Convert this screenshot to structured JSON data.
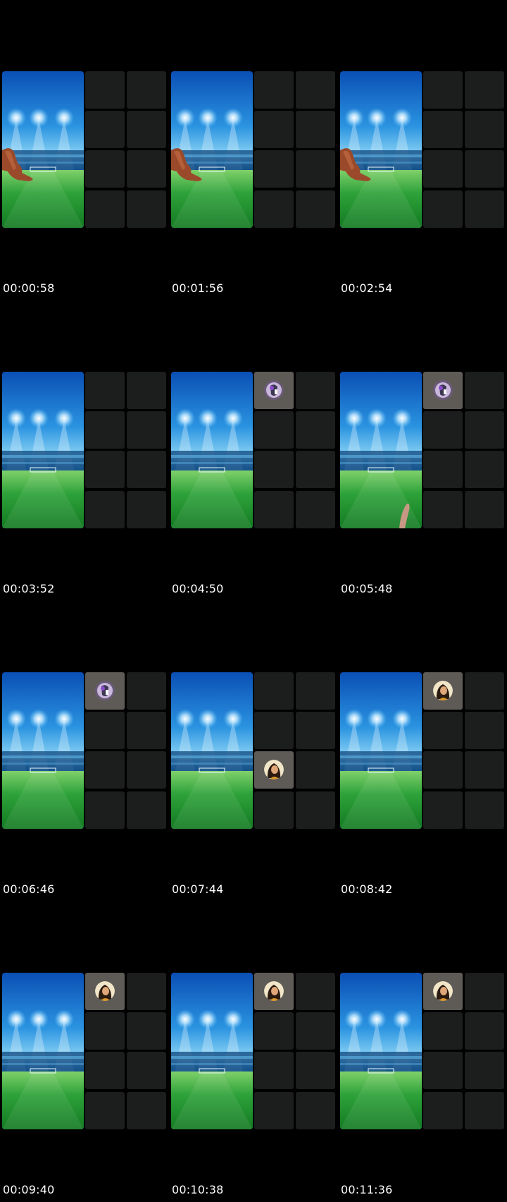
{
  "frames": [
    {
      "timestamp": "00:00:58",
      "leg": "full",
      "avatar": null
    },
    {
      "timestamp": "00:01:56",
      "leg": "full",
      "avatar": null
    },
    {
      "timestamp": "00:02:54",
      "leg": "full",
      "avatar": null
    },
    {
      "timestamp": "00:03:52",
      "leg": null,
      "avatar": null
    },
    {
      "timestamp": "00:04:50",
      "leg": null,
      "avatar": {
        "slot": [
          0,
          0
        ],
        "kind": "purple-avatar-icon"
      }
    },
    {
      "timestamp": "00:05:48",
      "leg": "partial",
      "avatar": {
        "slot": [
          0,
          0
        ],
        "kind": "purple-avatar-icon"
      }
    },
    {
      "timestamp": "00:06:46",
      "leg": null,
      "avatar": {
        "slot": [
          0,
          0
        ],
        "kind": "purple-avatar-icon"
      }
    },
    {
      "timestamp": "00:07:44",
      "leg": null,
      "avatar": {
        "slot": [
          2,
          0
        ],
        "kind": "woman-avatar-icon"
      }
    },
    {
      "timestamp": "00:08:42",
      "leg": null,
      "avatar": {
        "slot": [
          0,
          0
        ],
        "kind": "woman-avatar-icon"
      }
    },
    {
      "timestamp": "00:09:40",
      "leg": null,
      "avatar": {
        "slot": [
          0,
          0
        ],
        "kind": "woman-avatar-icon"
      }
    },
    {
      "timestamp": "00:10:38",
      "leg": null,
      "avatar": {
        "slot": [
          0,
          0
        ],
        "kind": "woman-avatar-icon"
      }
    },
    {
      "timestamp": "00:11:36",
      "leg": null,
      "avatar": {
        "slot": [
          0,
          0
        ],
        "kind": "woman-avatar-icon"
      }
    }
  ],
  "colors": {
    "background": "#000000",
    "empty_slot": "#1c1d1d",
    "filled_slot": "#5e5b57",
    "sky_top": "#0a4fb5",
    "pitch": "#1e8f2a"
  }
}
